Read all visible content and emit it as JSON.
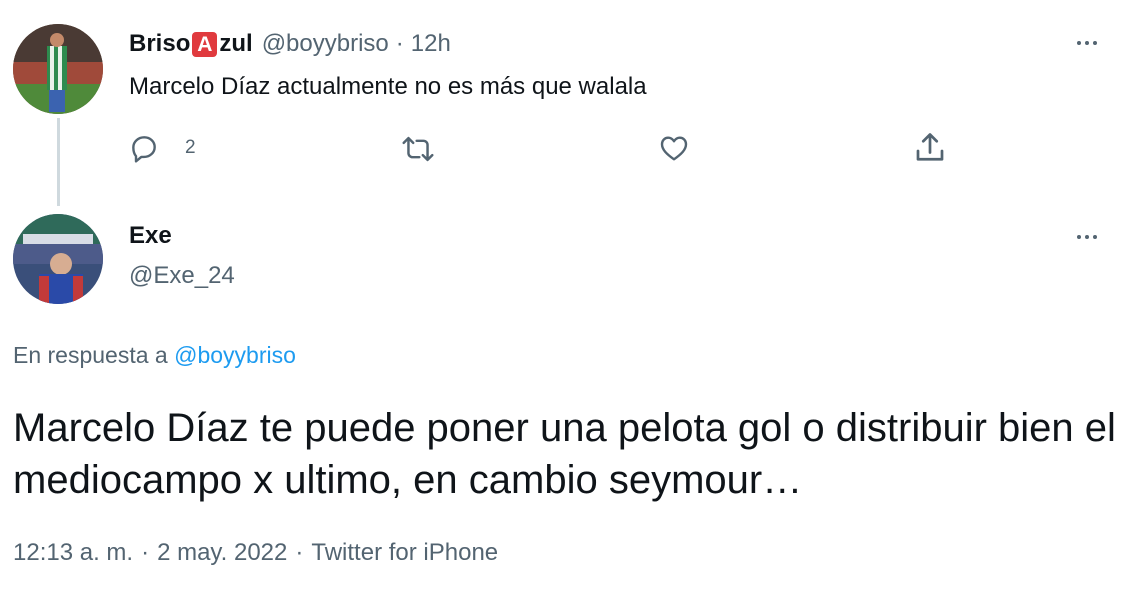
{
  "parent_tweet": {
    "name_part1": "Briso",
    "name_emoji": "A",
    "name_part2": "zul",
    "handle": "@boyybriso",
    "separator": "·",
    "time": "12h",
    "text": "Marcelo Díaz actualmente no es más que walala",
    "reply_count": "2"
  },
  "reply_tweet": {
    "name": "Exe",
    "handle": "@Exe_24",
    "reply_to_prefix": "En respuesta a",
    "reply_to_mention": "@boyybriso",
    "text": "Marcelo Díaz te puede poner una pelota gol o distribuir bien el mediocampo x ultimo, en cambio seymour…",
    "time": "12:13 a. m.",
    "date": "2 may. 2022",
    "source": "Twitter for iPhone",
    "separator": "·"
  },
  "icons": {
    "reply": "reply-icon",
    "retweet": "retweet-icon",
    "like": "heart-icon",
    "share": "share-icon",
    "more": "more-icon"
  },
  "colors": {
    "text_primary": "#0f1419",
    "text_secondary": "#536471",
    "link": "#1d9bf0",
    "thread_line": "#cfd9de",
    "emoji_red": "#e03a3e"
  }
}
